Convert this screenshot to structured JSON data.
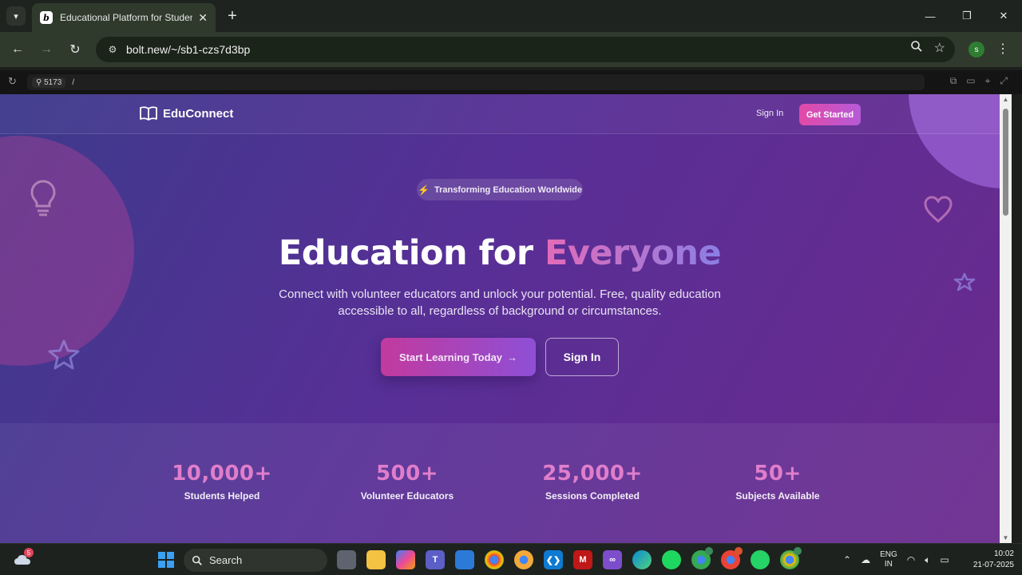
{
  "browser": {
    "tab": {
      "title": "Educational Platform for Students",
      "favicon": "b"
    },
    "url": "bolt.new/~/sb1-czs7d3bp",
    "profile_initial": "s"
  },
  "preview": {
    "port": "5173",
    "path": "/"
  },
  "site": {
    "brand": "EduConnect",
    "nav": {
      "sign_in": "Sign In",
      "get_started": "Get Started"
    },
    "badge": "Transforming Education Worldwide",
    "hero": {
      "title_main": "Education for ",
      "title_accent": "Everyone",
      "subtitle": "Connect with volunteer educators and unlock your potential. Free, quality education accessible to all, regardless of background or circumstances.",
      "primary_cta": "Start Learning Today",
      "secondary_cta": "Sign In"
    },
    "stats": [
      {
        "value": "10,000+",
        "label": "Students Helped"
      },
      {
        "value": "500+",
        "label": "Volunteer Educators"
      },
      {
        "value": "25,000+",
        "label": "Sessions Completed"
      },
      {
        "value": "50+",
        "label": "Subjects Available"
      }
    ],
    "colors": {
      "accent_pink": "#e24aa7",
      "accent_purple": "#8b7fe6",
      "stat_value": "#e07ecb"
    }
  },
  "taskbar": {
    "search": "Search",
    "weather_badge": "5",
    "lang_line1": "ENG",
    "lang_line2": "IN",
    "time": "10:02",
    "date": "21-07-2025",
    "apps": [
      "file-explorer-icon",
      "copilot-icon",
      "teams-icon",
      "store-icon",
      "chrome-icon",
      "chrome-canary-icon",
      "vscode-icon",
      "mcafee-icon",
      "visual-studio-icon",
      "edge-icon",
      "spotify-icon",
      "chrome-profile-icon",
      "chrome-profile-icon",
      "whatsapp-icon",
      "chrome-active-icon"
    ]
  }
}
